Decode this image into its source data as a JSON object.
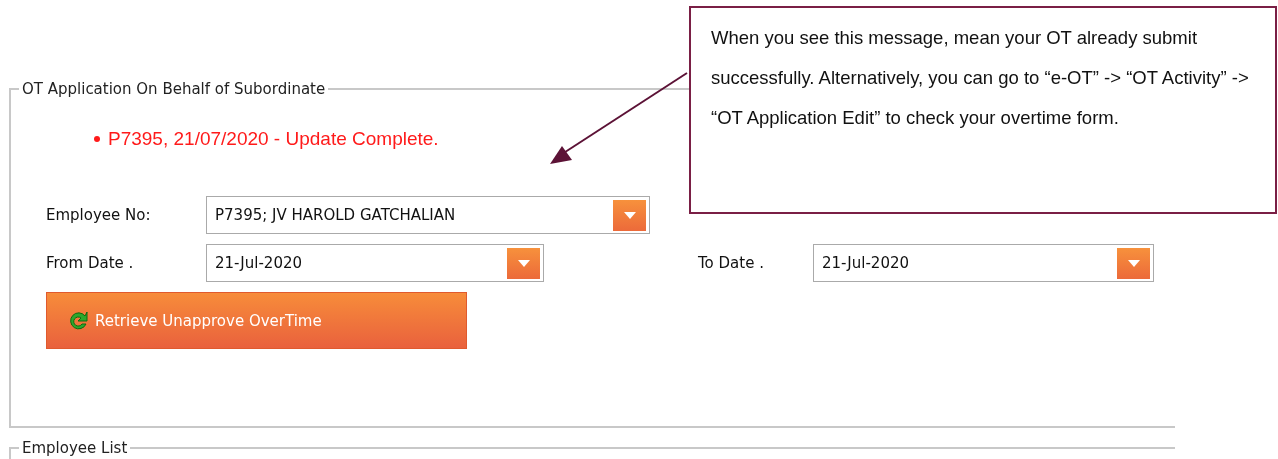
{
  "form": {
    "legend": "OT Application On Behalf of Subordinate",
    "message": "P7395, 21/07/2020 - Update Complete.",
    "employee": {
      "label": "Employee No:",
      "value": "P7395; JV HAROLD GATCHALIAN"
    },
    "from_date": {
      "label": "From Date .",
      "value": "21-Jul-2020"
    },
    "to_date": {
      "label": "To Date .",
      "value": "21-Jul-2020"
    },
    "button": "Retrieve Unapprove OverTime"
  },
  "employee_list": {
    "legend": "Employee List"
  },
  "callout": {
    "text": "When you see this message, mean your OT already submit successfully. Alternatively, you can go to “e-OT” -> “OT Activity” -> “OT Application Edit” to check your overtime form."
  }
}
